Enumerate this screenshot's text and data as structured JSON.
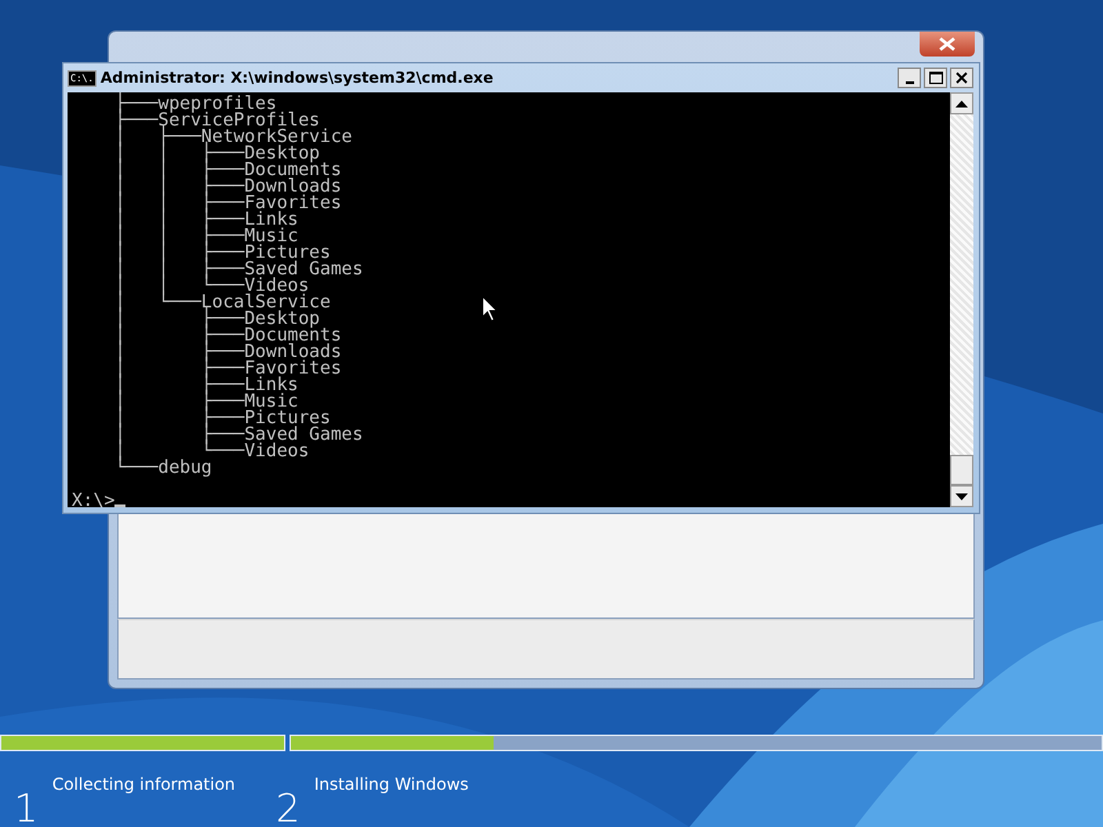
{
  "console_window": {
    "title": "Administrator: X:\\windows\\system32\\cmd.exe",
    "icon_text": "C:\\.",
    "lines": [
      "    ├───wpeprofiles",
      "    ├───ServiceProfiles",
      "    │   ├───NetworkService",
      "    │   │   ├───Desktop",
      "    │   │   ├───Documents",
      "    │   │   ├───Downloads",
      "    │   │   ├───Favorites",
      "    │   │   ├───Links",
      "    │   │   ├───Music",
      "    │   │   ├───Pictures",
      "    │   │   ├───Saved Games",
      "    │   │   └───Videos",
      "    │   └───LocalService",
      "    │       ├───Desktop",
      "    │       ├───Documents",
      "    │       ├───Downloads",
      "    │       ├───Favorites",
      "    │       ├───Links",
      "    │       ├───Music",
      "    │       ├───Pictures",
      "    │       ├───Saved Games",
      "    │       └───Videos",
      "    └───debug"
    ],
    "prompt": "X:\\>"
  },
  "progress": [
    {
      "level": 1
    },
    {
      "level": 0.25
    }
  ],
  "steps": [
    {
      "number": "1",
      "label": "Collecting information"
    },
    {
      "number": "2",
      "label": "Installing Windows"
    }
  ]
}
